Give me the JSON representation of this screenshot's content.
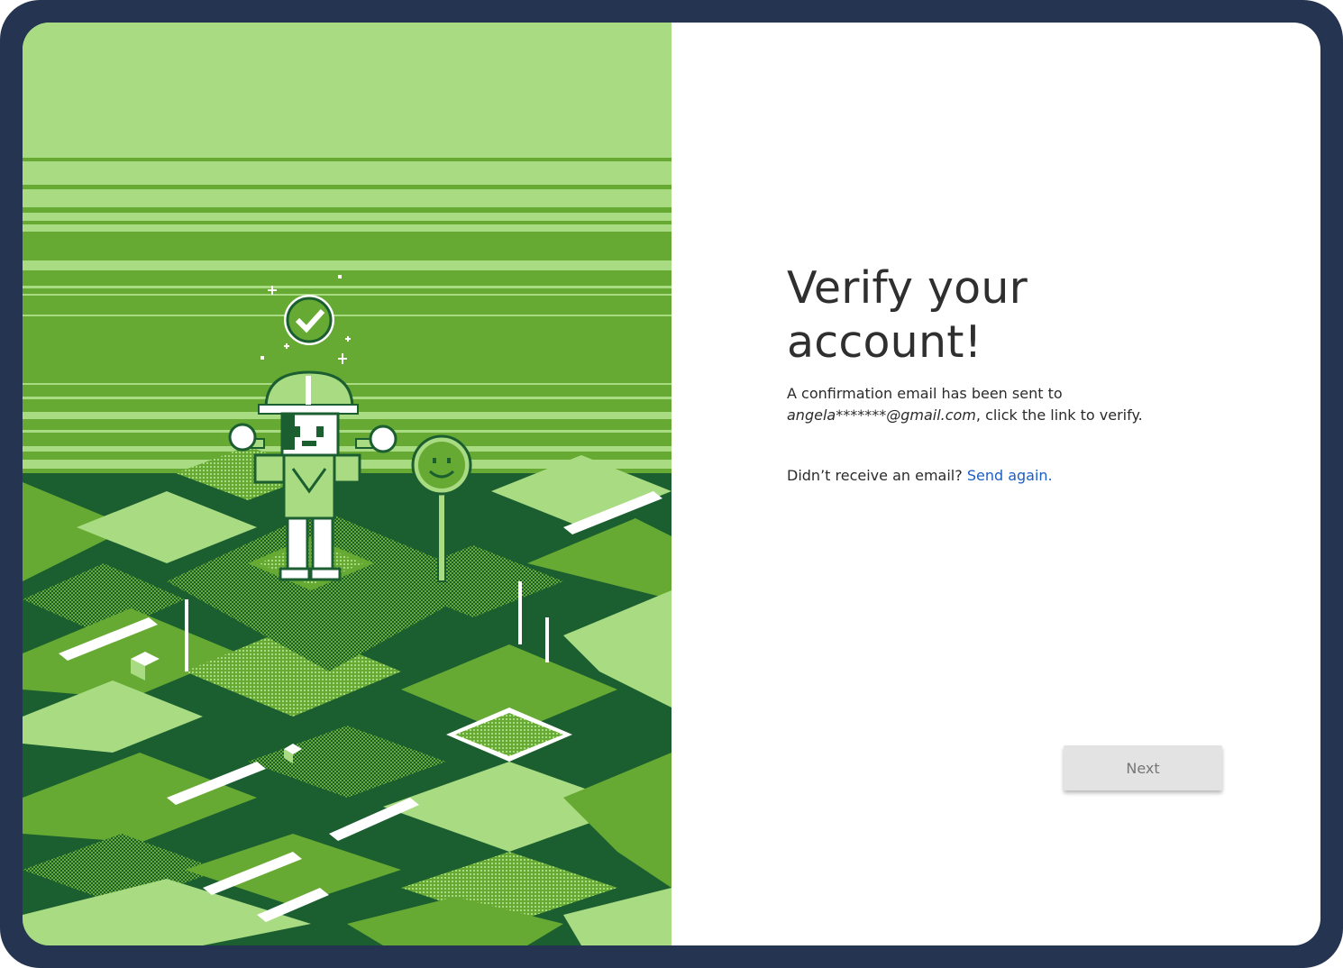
{
  "verify": {
    "title_line1": "Verify your",
    "title_line2": "account!",
    "message_prefix": "A confirmation email has been sent to",
    "email": "angela*******@gmail.com",
    "message_suffix": ", click the link to verify.",
    "resend_prompt": "Didn’t receive an email?",
    "resend_link": "Send again.",
    "next_label": "Next"
  },
  "colors": {
    "frame": "#253450",
    "link": "#1c5ec6",
    "button_bg": "#e3e3e3",
    "pixel_light": "#a9dc82",
    "pixel_mid": "#66aa33",
    "pixel_dark": "#1b5e30"
  },
  "illustration": {
    "description_icons": [
      "checkmark-badge-icon",
      "smiley-sign-icon"
    ]
  }
}
